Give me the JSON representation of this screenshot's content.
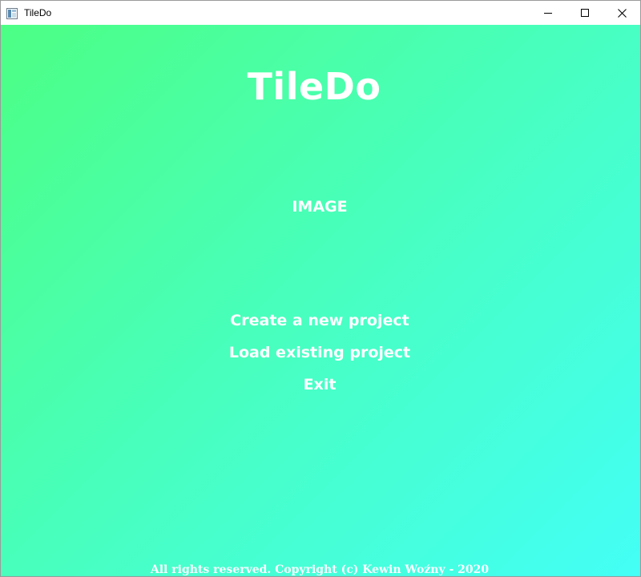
{
  "window": {
    "title": "TileDo",
    "controls": {
      "minimize_icon": "minimize-icon",
      "maximize_icon": "maximize-icon",
      "close_icon": "close-icon"
    }
  },
  "main": {
    "app_title": "TileDo",
    "image_placeholder": "IMAGE",
    "menu": [
      {
        "label": "Create a new project"
      },
      {
        "label": "Load existing project"
      },
      {
        "label": "Exit"
      }
    ],
    "footer": "All rights reserved. Copyright (c) Kewin Woźny - 2020"
  },
  "colors": {
    "gradient_start": "#4cff84",
    "gradient_end": "#43fff6",
    "text": "#ffffff"
  }
}
